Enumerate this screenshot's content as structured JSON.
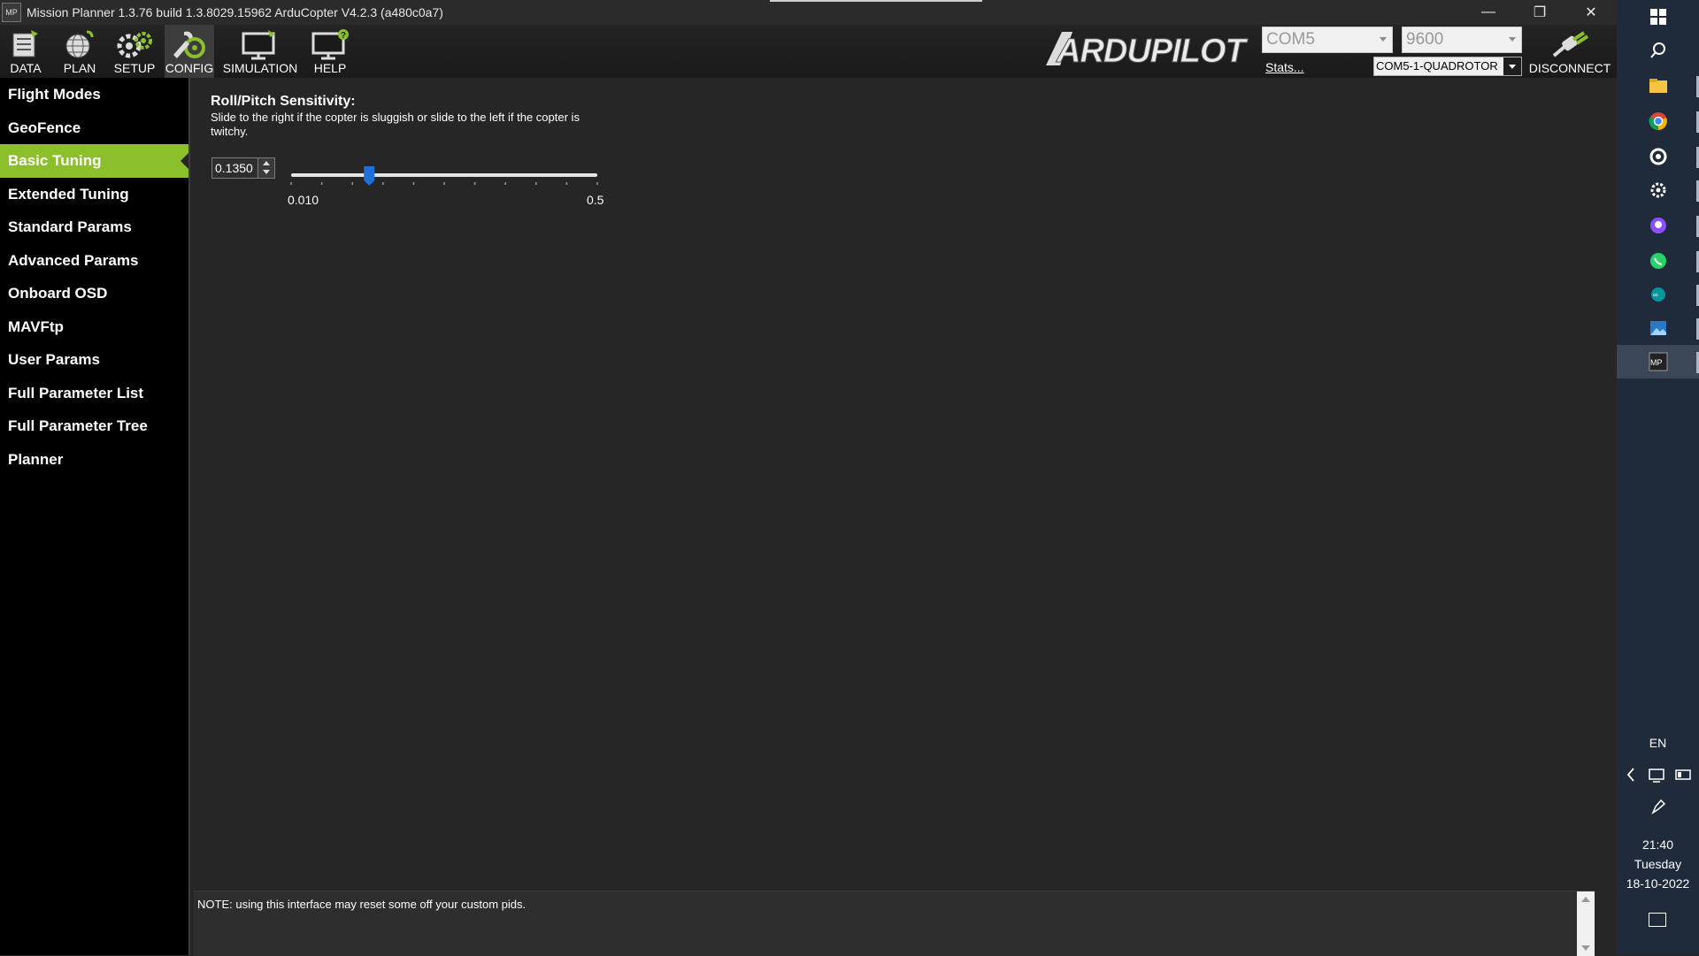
{
  "window": {
    "title": "Mission Planner 1.3.76 build 1.3.8029.15962 ArduCopter V4.2.3 (a480c0a7)",
    "app_icon_text": "MP",
    "minimize": "—",
    "maximize": "❐",
    "close": "✕"
  },
  "toolbar": {
    "buttons": [
      {
        "label": "DATA"
      },
      {
        "label": "PLAN"
      },
      {
        "label": "SETUP"
      },
      {
        "label": "CONFIG",
        "active": true
      },
      {
        "label": "SIMULATION"
      },
      {
        "label": "HELP"
      }
    ],
    "logo_text": "ARDUPILOT",
    "port": "COM5",
    "baud": "9600",
    "stats_link": "Stats...",
    "profile": "COM5-1-QUADROTOR",
    "disconnect_label": "DISCONNECT",
    "accent": "#8cbf2c"
  },
  "sidebar": {
    "items": [
      {
        "label": "Flight Modes"
      },
      {
        "label": "GeoFence"
      },
      {
        "label": "Basic Tuning",
        "active": true
      },
      {
        "label": "Extended Tuning"
      },
      {
        "label": "Standard Params"
      },
      {
        "label": "Advanced Params"
      },
      {
        "label": "Onboard OSD"
      },
      {
        "label": "MAVFtp"
      },
      {
        "label": "User Params"
      },
      {
        "label": "Full Parameter List"
      },
      {
        "label": "Full Parameter Tree"
      },
      {
        "label": "Planner"
      }
    ]
  },
  "main": {
    "param_title": "Roll/Pitch Sensitivity:",
    "param_desc": "Slide to the right if the copter is sluggish or slide to the left if the copter is twitchy.",
    "value": "0.1350",
    "slider_min": "0.010",
    "slider_max": "0.5",
    "slider_value": 0.135,
    "note": "NOTE: using this interface may reset some off your custom pids."
  },
  "taskbar": {
    "icons": [
      "windows-start-icon",
      "search-icon",
      "file-explorer-icon",
      "chrome-icon",
      "app-icon",
      "settings-icon",
      "github-icon",
      "whatsapp-icon",
      "arduino-icon",
      "photos-icon",
      "mission-planner-icon"
    ],
    "language": "EN",
    "time": "21:40",
    "day": "Tuesday",
    "date": "18-10-2022"
  }
}
